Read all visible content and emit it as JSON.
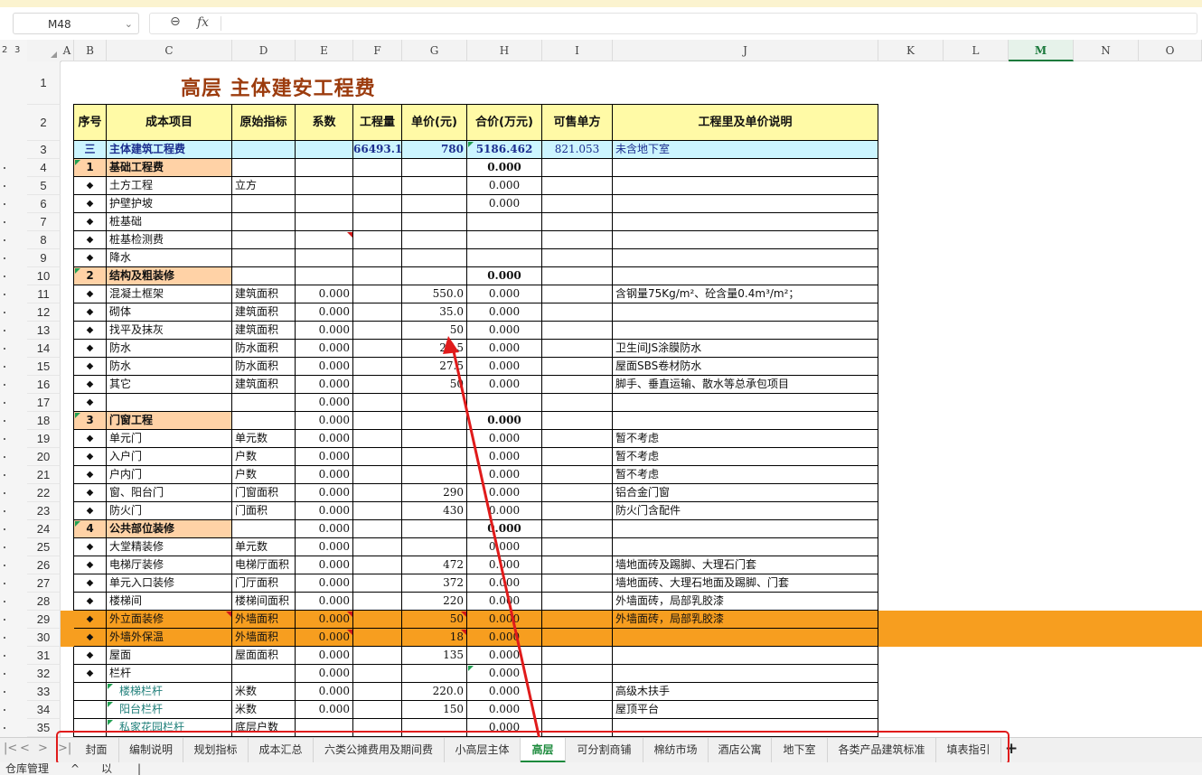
{
  "formula_bar": {
    "cell_ref": "M48",
    "zoom_icon": "zoom-icon",
    "fx_label": "fx",
    "content": ""
  },
  "outline": {
    "levels": [
      "2",
      "3"
    ]
  },
  "columns": [
    "A",
    "B",
    "C",
    "D",
    "E",
    "F",
    "G",
    "H",
    "I",
    "J",
    "K",
    "L",
    "M",
    "N",
    "O"
  ],
  "selected_column": "M",
  "row_numbers": [
    "1",
    "2",
    "3",
    "4",
    "5",
    "6",
    "7",
    "8",
    "9",
    "10",
    "11",
    "12",
    "13",
    "14",
    "15",
    "16",
    "17",
    "18",
    "19",
    "20",
    "21",
    "22",
    "23",
    "24",
    "25",
    "26",
    "27",
    "28",
    "29",
    "30",
    "31",
    "32",
    "33",
    "34",
    "35"
  ],
  "title": "高层 主体建安工程费",
  "headers": [
    "序号",
    "成本项目",
    "原始指标",
    "系数",
    "工程量",
    "单价(元)",
    "合价(万元)",
    "可售单方",
    "工程里及单价说明"
  ],
  "summary_row": {
    "seq": "三",
    "item": "主体建筑工程费",
    "indicator": "",
    "coef": "",
    "quantity": "66493.1",
    "price": "780",
    "total": "5186.462",
    "unit_sale": "821.053",
    "note": "未含地下室"
  },
  "rows": [
    {
      "seq": "1",
      "item": "基础工程费",
      "indicator": "",
      "coef": "",
      "price": "",
      "total": "0.000",
      "note": "",
      "type": "section"
    },
    {
      "seq": "◆",
      "item": "土方工程",
      "indicator": "立方",
      "coef": "",
      "price": "",
      "total": "0.000",
      "note": ""
    },
    {
      "seq": "◆",
      "item": "护壁护坡",
      "indicator": "",
      "coef": "",
      "price": "",
      "total": "0.000",
      "note": ""
    },
    {
      "seq": "◆",
      "item": "桩基础",
      "indicator": "",
      "coef": "",
      "price": "",
      "total": "",
      "note": ""
    },
    {
      "seq": "◆",
      "item": "桩基检测费",
      "indicator": "",
      "coef": "",
      "price": "",
      "total": "",
      "note": ""
    },
    {
      "seq": "◆",
      "item": "降水",
      "indicator": "",
      "coef": "",
      "price": "",
      "total": "",
      "note": ""
    },
    {
      "seq": "2",
      "item": "结构及粗装修",
      "indicator": "",
      "coef": "",
      "price": "",
      "total": "0.000",
      "note": "",
      "type": "section"
    },
    {
      "seq": "◆",
      "item": "混凝土框架",
      "indicator": "建筑面积",
      "coef": "0.000",
      "price": "550.0",
      "total": "0.000",
      "note": "含钢量75Kg/m²、砼含量0.4m³/m²；"
    },
    {
      "seq": "◆",
      "item": "砌体",
      "indicator": "建筑面积",
      "coef": "0.000",
      "price": "35.0",
      "total": "0.000",
      "note": ""
    },
    {
      "seq": "◆",
      "item": "找平及抹灰",
      "indicator": "建筑面积",
      "coef": "0.000",
      "price": "50",
      "total": "0.000",
      "note": ""
    },
    {
      "seq": "◆",
      "item": "防水",
      "indicator": "防水面积",
      "coef": "0.000",
      "price": "22.5",
      "total": "0.000",
      "note": "卫生间JS涂膜防水"
    },
    {
      "seq": "◆",
      "item": "防水",
      "indicator": "防水面积",
      "coef": "0.000",
      "price": "27.5",
      "total": "0.000",
      "note": "屋面SBS卷材防水"
    },
    {
      "seq": "◆",
      "item": "其它",
      "indicator": "建筑面积",
      "coef": "0.000",
      "price": "50",
      "total": "0.000",
      "note": "脚手、垂直运输、散水等总承包项目"
    },
    {
      "seq": "◆",
      "item": "",
      "indicator": "",
      "coef": "0.000",
      "price": "",
      "total": "",
      "note": ""
    },
    {
      "seq": "3",
      "item": "门窗工程",
      "indicator": "",
      "coef": "0.000",
      "price": "",
      "total": "0.000",
      "note": "",
      "type": "section"
    },
    {
      "seq": "◆",
      "item": "单元门",
      "indicator": "单元数",
      "coef": "0.000",
      "price": "",
      "total": "0.000",
      "note": "暂不考虑"
    },
    {
      "seq": "◆",
      "item": "入户门",
      "indicator": "户数",
      "coef": "0.000",
      "price": "",
      "total": "0.000",
      "note": "暂不考虑"
    },
    {
      "seq": "◆",
      "item": "户内门",
      "indicator": "户数",
      "coef": "0.000",
      "price": "",
      "total": "0.000",
      "note": "暂不考虑"
    },
    {
      "seq": "◆",
      "item": "窗、阳台门",
      "indicator": "门窗面积",
      "coef": "0.000",
      "price": "290",
      "total": "0.000",
      "note": "铝合金门窗"
    },
    {
      "seq": "◆",
      "item": "防火门",
      "indicator": "门面积",
      "coef": "0.000",
      "price": "430",
      "total": "0.000",
      "note": "防火门含配件"
    },
    {
      "seq": "4",
      "item": "公共部位装修",
      "indicator": "",
      "coef": "0.000",
      "price": "",
      "total": "0.000",
      "note": "",
      "type": "section"
    },
    {
      "seq": "◆",
      "item": "大堂精装修",
      "indicator": "单元数",
      "coef": "0.000",
      "price": "",
      "total": "0.000",
      "note": ""
    },
    {
      "seq": "◆",
      "item": "电梯厅装修",
      "indicator": "电梯厅面积",
      "coef": "0.000",
      "price": "472",
      "total": "0.000",
      "note": "墙地面砖及踢脚、大理石门套"
    },
    {
      "seq": "◆",
      "item": "单元入口装修",
      "indicator": "门厅面积",
      "coef": "0.000",
      "price": "372",
      "total": "0.000",
      "note": "墙地面砖、大理石地面及踢脚、门套"
    },
    {
      "seq": "◆",
      "item": "楼梯间",
      "indicator": "楼梯间面积",
      "coef": "0.000",
      "price": "220",
      "total": "0.000",
      "note": "外墙面砖，局部乳胶漆"
    },
    {
      "seq": "◆",
      "item": "外立面装修",
      "indicator": "外墙面积",
      "coef": "0.000",
      "price": "50",
      "total": "0.000",
      "note": "外墙面砖，局部乳胶漆",
      "type": "hl"
    },
    {
      "seq": "◆",
      "item": "外墙外保温",
      "indicator": "外墙面积",
      "coef": "0.000",
      "price": "18",
      "total": "0.000",
      "note": "",
      "type": "hl"
    },
    {
      "seq": "◆",
      "item": "屋面",
      "indicator": "屋面面积",
      "coef": "0.000",
      "price": "135",
      "total": "0.000",
      "note": ""
    },
    {
      "seq": "◆",
      "item": "栏杆",
      "indicator": "",
      "coef": "0.000",
      "price": "",
      "total": "0.000",
      "note": ""
    },
    {
      "seq": "",
      "item": "楼梯栏杆",
      "indicator": "米数",
      "coef": "0.000",
      "price": "220.0",
      "total": "0.000",
      "note": "高级木扶手",
      "type": "sub"
    },
    {
      "seq": "",
      "item": "阳台栏杆",
      "indicator": "米数",
      "coef": "0.000",
      "price": "150",
      "total": "0.000",
      "note": "屋顶平台",
      "type": "sub"
    },
    {
      "seq": "",
      "item": "私家花园栏杆",
      "indicator": "底层户数",
      "coef": "",
      "price": "",
      "total": "0.000",
      "note": "",
      "type": "sub"
    }
  ],
  "sheet_tabs": [
    "封面",
    "编制说明",
    "规划指标",
    "成本汇总",
    "六类公摊费用及期间费",
    "小高层主体",
    "高层",
    "可分割商铺",
    "棉纺市场",
    "酒店公寓",
    "地下室",
    "各类产品建筑标准",
    "填表指引"
  ],
  "active_tab": "高层",
  "add_sheet_label": "+",
  "tab_nav": [
    "|<",
    "<",
    ">",
    ">|"
  ],
  "status_bar": [
    "仓库管理",
    "^",
    "以",
    "|"
  ],
  "annotation_color": "#e01b1b"
}
